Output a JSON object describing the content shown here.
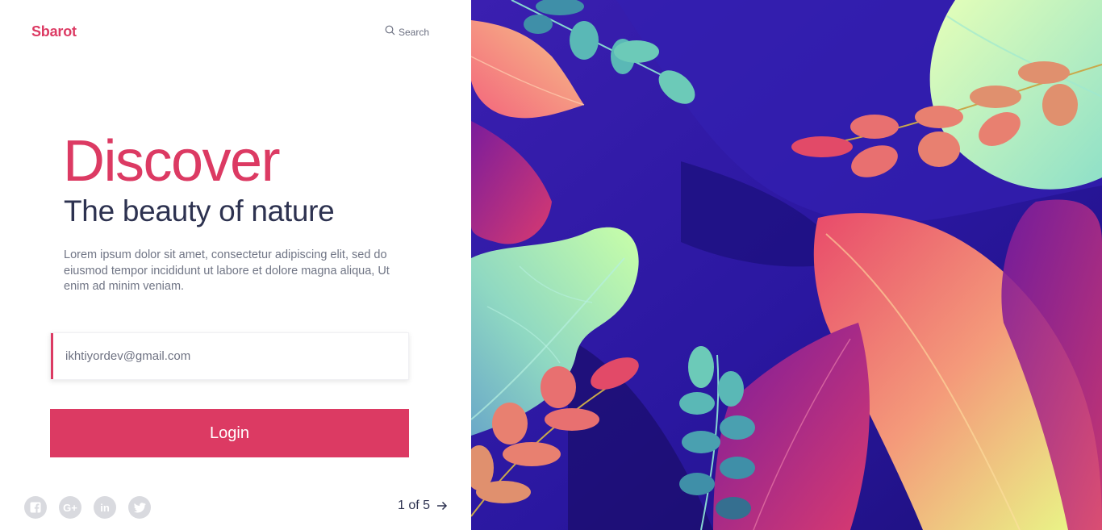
{
  "brand": {
    "name": "Sbarot"
  },
  "search": {
    "label": "Search",
    "icon": "search-icon"
  },
  "hero": {
    "title": "Discover",
    "subtitle": "The beauty of nature",
    "description": "Lorem ipsum dolor sit amet, consectetur adipiscing elit, sed do eiusmod tempor incididunt ut labore et dolore magna aliqua, Ut enim ad minim veniam."
  },
  "form": {
    "email_value": "ikhtiyordev@gmail.com",
    "login_label": "Login"
  },
  "social": [
    {
      "icon": "facebook-icon",
      "glyph": "f"
    },
    {
      "icon": "google-plus-icon",
      "glyph": "G+"
    },
    {
      "icon": "linkedin-icon",
      "glyph": "in"
    },
    {
      "icon": "twitter-icon",
      "glyph": "t"
    }
  ],
  "pager": {
    "text": "1 of 5",
    "icon": "arrow-right-icon"
  },
  "colors": {
    "accent": "#dc3a63",
    "heading": "#2d3250",
    "text": "#707585",
    "social_bg": "#d9dadf",
    "illustration_bg": "#2a1a9e"
  }
}
